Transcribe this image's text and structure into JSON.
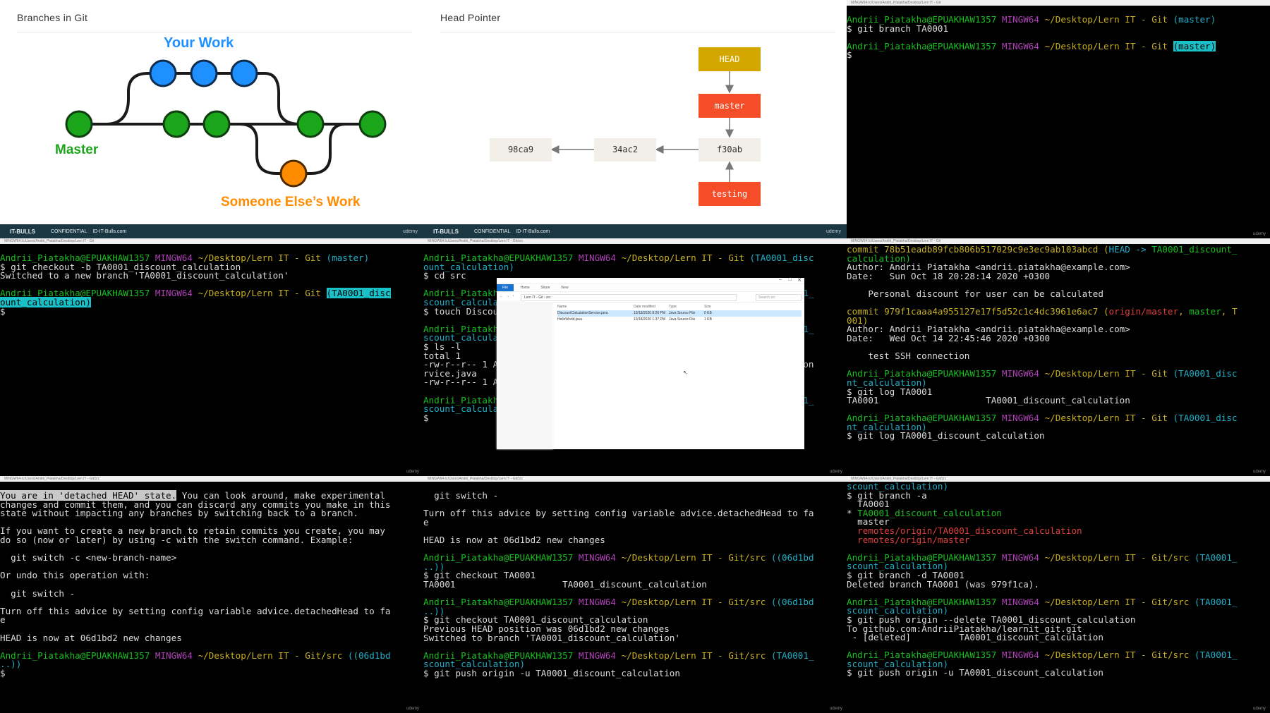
{
  "colors": {
    "green": "#18c020",
    "magenta": "#b040b8",
    "yellow": "#c8b020",
    "cyan": "#20b0c8",
    "red": "#e0403c",
    "highlight": "#1ac0c8",
    "node_green": "#1aa51a",
    "node_blue": "#1e90ff",
    "node_orange": "#ff8c00",
    "head_gold": "#d4a700",
    "branch_red": "#f44d27",
    "commit_box": "#f1efe7"
  },
  "slide1": {
    "title": "Branches in Git",
    "your_work": "Your Work",
    "master": "Master",
    "someone": "Someone Else’s Work",
    "footer_logo": "IT-BULLS",
    "footer_conf": "CONFIDENTIAL",
    "footer_site": "ID-IT-Bulls.com",
    "footer_mark": "udemy"
  },
  "slide2": {
    "title": "Head Pointer",
    "head": "HEAD",
    "master": "master",
    "testing": "testing",
    "commits": [
      "98ca9",
      "34ac2",
      "f30ab"
    ],
    "footer_logo": "IT-BULLS",
    "footer_conf": "CONFIDENTIAL",
    "footer_site": "ID-IT-Bulls.com",
    "footer_mark": "udemy"
  },
  "titlebars": {
    "p3": "MINGW64:/c/Users/Andrii_Piatakha/Desktop/Lern IT - Git",
    "p4": "MINGW64:/c/Users/Andrii_Piatakha/Desktop/Lern IT - Git",
    "p5": "MINGW64:/c/Users/Andrii_Piatakha/Desktop/Lern IT - Git/src",
    "p6": "MINGW64:/c/Users/Andrii_Piatakha/Desktop/Lern IT - Git",
    "p7": "MINGW64:/c/Users/Andrii_Piatakha/Desktop/Lern IT - Git/src",
    "p8": "MINGW64:/c/Users/Andrii_Piatakha/Desktop/Lern IT - Git/src",
    "p9": "MINGW64:/c/Users/Andrii_Piatakha/Desktop/Lern IT - Git/src"
  },
  "watermark": "udemy",
  "explorer": {
    "path": "Lern IT - Git › src",
    "search": "Search src",
    "cols": [
      "Name",
      "Date modified",
      "Type",
      "Size"
    ],
    "files": [
      {
        "name": "DiscountCalculationService.java",
        "date": "10/18/2020 8:26 PM",
        "type": "Java Source File",
        "size": "0 KB"
      },
      {
        "name": "HelloWorld.java",
        "date": "10/18/2020 1:37 PM",
        "type": "Java Source File",
        "size": "1 KB"
      }
    ]
  },
  "terminals": {
    "p3": [
      [
        [
          "Andrii_Piatakha@EPUAKHAW1357",
          "g"
        ],
        [
          " MINGW64",
          "m"
        ],
        [
          " ~/Desktop/Lern IT - Git",
          "y"
        ],
        [
          " (master)",
          "c"
        ]
      ],
      [
        [
          "$ git branch TA0001",
          ""
        ]
      ],
      [
        [
          "",
          ""
        ]
      ],
      [
        [
          "Andrii_Piatakha@EPUAKHAW1357",
          "g"
        ],
        [
          " MINGW64",
          "m"
        ],
        [
          " ~/Desktop/Lern IT - Git",
          "y"
        ],
        [
          " ",
          ""
        ],
        [
          "(master)",
          "hl"
        ]
      ],
      [
        [
          "$ ",
          ""
        ]
      ]
    ],
    "p4": [
      [
        [
          "Andrii_Piatakha@EPUAKHAW1357",
          "g"
        ],
        [
          " MINGW64",
          "m"
        ],
        [
          " ~/Desktop/Lern IT - Git",
          "y"
        ],
        [
          " (master)",
          "c"
        ]
      ],
      [
        [
          "$ git checkout -b TA0001_discount_calculation",
          ""
        ]
      ],
      [
        [
          "Switched to a new branch 'TA0001_discount_calculation'",
          ""
        ]
      ],
      [
        [
          "",
          ""
        ]
      ],
      [
        [
          "Andrii_Piatakha@EPUAKHAW1357",
          "g"
        ],
        [
          " MINGW64",
          "m"
        ],
        [
          " ~/Desktop/Lern IT - Git",
          "y"
        ],
        [
          " ",
          ""
        ],
        [
          "(TA0001_disc",
          "hl"
        ]
      ],
      [
        [
          "ount_calculation)",
          "hl"
        ]
      ],
      [
        [
          "$ ",
          ""
        ]
      ],
      [
        [
          "",
          ""
        ]
      ],
      [
        [
          "",
          ""
        ]
      ],
      [
        [
          "",
          ""
        ]
      ],
      [
        [
          "",
          ""
        ]
      ],
      [
        [
          "",
          ""
        ]
      ],
      [
        [
          "",
          ""
        ]
      ],
      [
        [
          "",
          ""
        ]
      ],
      [
        [
          "",
          ""
        ]
      ],
      [
        [
          "",
          ""
        ]
      ]
    ],
    "p5": [
      [
        [
          "Andrii_Piatakha@EPUAKHAW1357",
          "g"
        ],
        [
          " MINGW64",
          "m"
        ],
        [
          " ~/Desktop/Lern IT - Git",
          "y"
        ],
        [
          " (TA0001_disc",
          "c"
        ]
      ],
      [
        [
          "ount_calculation)",
          "c"
        ]
      ],
      [
        [
          "$ cd src",
          ""
        ]
      ],
      [
        [
          "",
          ""
        ]
      ],
      [
        [
          "Andrii_Piatakha@EPUAKHAW1357",
          "g"
        ],
        [
          " MINGW64",
          "m"
        ],
        [
          " ~/Desktop/Lern IT - Git/src",
          "y"
        ],
        [
          " (TA0001_",
          "c"
        ]
      ],
      [
        [
          "scount_calculation)",
          "c"
        ]
      ],
      [
        [
          "$ touch DiscountCalculationService.java",
          ""
        ]
      ],
      [
        [
          "",
          ""
        ]
      ],
      [
        [
          "Andrii_Piatakha@EPUAKHAW1357",
          "g"
        ],
        [
          " MINGW64",
          "m"
        ],
        [
          " ~/Desktop/Lern IT - Git/src",
          "y"
        ],
        [
          " (TA0001_",
          "c"
        ]
      ],
      [
        [
          "scount_calculation)",
          "c"
        ]
      ],
      [
        [
          "$ ls -l",
          ""
        ]
      ],
      [
        [
          "total 1",
          ""
        ]
      ],
      [
        [
          "-rw-r--r-- 1 Andrii_Piatakha 1049089   0 Oct 18 20:26 DiscountCalculation",
          ""
        ]
      ],
      [
        [
          "rvice.java                                              ulation",
          ""
        ]
      ],
      [
        [
          "-rw-r--r-- 1 Andrii_Piatakha 1049089 120 Oct 18 13:37 HelloWorld.java",
          ""
        ]
      ],
      [
        [
          "",
          ""
        ]
      ],
      [
        [
          "Andrii_Piatakha@EPUAKHAW1357",
          "g"
        ],
        [
          " MINGW64",
          "m"
        ],
        [
          " ~/Desktop/Lern IT - Git/src",
          "y"
        ],
        [
          " (TA0001_",
          "c"
        ]
      ],
      [
        [
          "scount_calculation)",
          "c"
        ]
      ],
      [
        [
          "$ ",
          ""
        ]
      ]
    ],
    "p6": [
      [
        [
          "commit 78b51eadb89fcb806b517029c9e3ec9ab103abcd",
          "y"
        ],
        [
          " (",
          "y"
        ],
        [
          "HEAD -> ",
          "c"
        ],
        [
          "TA0001_discount_",
          "g"
        ]
      ],
      [
        [
          "calculation)",
          "g"
        ]
      ],
      [
        [
          "Author: Andrii Piatakha <andrii.piatakha@example.com>",
          ""
        ]
      ],
      [
        [
          "Date:   Sun Oct 18 20:28:14 2020 +0300",
          ""
        ]
      ],
      [
        [
          "",
          ""
        ]
      ],
      [
        [
          "    Personal discount for user can be calculated",
          ""
        ]
      ],
      [
        [
          "",
          ""
        ]
      ],
      [
        [
          "commit 979f1caaa4a955127e17f5d52c1c4dc3961e6ac7",
          "y"
        ],
        [
          " (",
          "y"
        ],
        [
          "origin/master",
          "r"
        ],
        [
          ", ",
          "y"
        ],
        [
          "master",
          "g"
        ],
        [
          ", T",
          "y"
        ]
      ],
      [
        [
          "001)",
          "y"
        ]
      ],
      [
        [
          "Author: Andrii Piatakha <andrii.piatakha@example.com>",
          ""
        ]
      ],
      [
        [
          "Date:   Wed Oct 14 22:45:46 2020 +0300",
          ""
        ]
      ],
      [
        [
          "",
          ""
        ]
      ],
      [
        [
          "    test SSH connection",
          ""
        ]
      ],
      [
        [
          "",
          ""
        ]
      ],
      [
        [
          "Andrii_Piatakha@EPUAKHAW1357",
          "g"
        ],
        [
          " MINGW64",
          "m"
        ],
        [
          " ~/Desktop/Lern IT - Git",
          "y"
        ],
        [
          " (TA0001_disc",
          "c"
        ]
      ],
      [
        [
          "nt_calculation)",
          "c"
        ]
      ],
      [
        [
          "$ git log TA0001",
          ""
        ]
      ],
      [
        [
          "TA0001                    TA0001_discount_calculation",
          ""
        ]
      ],
      [
        [
          "",
          ""
        ]
      ],
      [
        [
          "Andrii_Piatakha@EPUAKHAW1357",
          "g"
        ],
        [
          " MINGW64",
          "m"
        ],
        [
          " ~/Desktop/Lern IT - Git",
          "y"
        ],
        [
          " (TA0001_disc",
          "c"
        ]
      ],
      [
        [
          "nt_calculation)",
          "c"
        ]
      ],
      [
        [
          "$ git log TA0001_discount_calculation ",
          ""
        ]
      ]
    ],
    "p7": [
      [
        [
          "You are in 'detached HEAD' state.",
          "hlw"
        ],
        [
          " You can look around, make experimental",
          ""
        ]
      ],
      [
        [
          "changes and commit them, and you can discard any commits you make in this",
          ""
        ]
      ],
      [
        [
          "state without impacting any branches by switching back to a branch.",
          ""
        ]
      ],
      [
        [
          "",
          ""
        ]
      ],
      [
        [
          "If you want to create a new branch to retain commits you create, you may",
          ""
        ]
      ],
      [
        [
          "do so (now or later) by using -c with the switch command. Example:",
          ""
        ]
      ],
      [
        [
          "",
          ""
        ]
      ],
      [
        [
          "  git switch -c <new-branch-name>",
          ""
        ]
      ],
      [
        [
          "",
          ""
        ]
      ],
      [
        [
          "Or undo this operation with:",
          ""
        ]
      ],
      [
        [
          "",
          ""
        ]
      ],
      [
        [
          "  git switch -",
          ""
        ]
      ],
      [
        [
          "",
          ""
        ]
      ],
      [
        [
          "Turn off this advice by setting config variable advice.detachedHead to fa",
          ""
        ]
      ],
      [
        [
          "e",
          ""
        ]
      ],
      [
        [
          "",
          ""
        ]
      ],
      [
        [
          "HEAD is now at 06d1bd2 new changes",
          ""
        ]
      ],
      [
        [
          "",
          ""
        ]
      ],
      [
        [
          "Andrii_Piatakha@EPUAKHAW1357",
          "g"
        ],
        [
          " MINGW64",
          "m"
        ],
        [
          " ~/Desktop/Lern IT - Git/src",
          "y"
        ],
        [
          " ((06d1bd",
          "c"
        ]
      ],
      [
        [
          "..))",
          "c"
        ]
      ],
      [
        [
          "$ ",
          ""
        ]
      ]
    ],
    "p8": [
      [
        [
          "  git switch -",
          ""
        ]
      ],
      [
        [
          "",
          ""
        ]
      ],
      [
        [
          "Turn off this advice by setting config variable advice.detachedHead to fa",
          ""
        ]
      ],
      [
        [
          "e",
          ""
        ]
      ],
      [
        [
          "",
          ""
        ]
      ],
      [
        [
          "HEAD is now at 06d1bd2 new changes",
          ""
        ]
      ],
      [
        [
          "",
          ""
        ]
      ],
      [
        [
          "Andrii_Piatakha@EPUAKHAW1357",
          "g"
        ],
        [
          " MINGW64",
          "m"
        ],
        [
          " ~/Desktop/Lern IT - Git/src",
          "y"
        ],
        [
          " ((06d1bd",
          "c"
        ]
      ],
      [
        [
          "..))",
          "c"
        ]
      ],
      [
        [
          "$ git checkout TA0001",
          ""
        ]
      ],
      [
        [
          "TA0001                    TA0001_discount_calculation",
          ""
        ]
      ],
      [
        [
          "",
          ""
        ]
      ],
      [
        [
          "Andrii_Piatakha@EPUAKHAW1357",
          "g"
        ],
        [
          " MINGW64",
          "m"
        ],
        [
          " ~/Desktop/Lern IT - Git/src",
          "y"
        ],
        [
          " ((06d1bd",
          "c"
        ]
      ],
      [
        [
          "..))",
          "c"
        ]
      ],
      [
        [
          "$ git checkout TA0001_discount_calculation",
          ""
        ]
      ],
      [
        [
          "Previous HEAD position was 06d1bd2 new changes",
          ""
        ]
      ],
      [
        [
          "Switched to branch 'TA0001_discount_calculation'",
          ""
        ]
      ],
      [
        [
          "",
          ""
        ]
      ],
      [
        [
          "Andrii_Piatakha@EPUAKHAW1357",
          "g"
        ],
        [
          " MINGW64",
          "m"
        ],
        [
          " ~/Desktop/Lern IT - Git/src",
          "y"
        ],
        [
          " (TA0001_",
          "c"
        ]
      ],
      [
        [
          "scount_calculation)",
          "c"
        ]
      ],
      [
        [
          "$ git push origin -u TA0001_discount_calculation ",
          ""
        ]
      ]
    ],
    "p9": [
      [
        [
          "scount_calculation)",
          "c"
        ]
      ],
      [
        [
          "$ git branch -a",
          ""
        ]
      ],
      [
        [
          "  TA0001",
          ""
        ]
      ],
      [
        [
          "* ",
          ""
        ],
        [
          "TA0001_discount_calculation",
          "g"
        ]
      ],
      [
        [
          "  master",
          ""
        ]
      ],
      [
        [
          "  remotes/origin/TA0001_discount_calculation",
          "r"
        ]
      ],
      [
        [
          "  remotes/origin/master",
          "r"
        ]
      ],
      [
        [
          "",
          ""
        ]
      ],
      [
        [
          "Andrii_Piatakha@EPUAKHAW1357",
          "g"
        ],
        [
          " MINGW64",
          "m"
        ],
        [
          " ~/Desktop/Lern IT - Git/src",
          "y"
        ],
        [
          " (TA0001_",
          "c"
        ]
      ],
      [
        [
          "scount_calculation)",
          "c"
        ]
      ],
      [
        [
          "$ git branch -d TA0001",
          ""
        ]
      ],
      [
        [
          "Deleted branch TA0001 (was 979f1ca).",
          ""
        ]
      ],
      [
        [
          "",
          ""
        ]
      ],
      [
        [
          "Andrii_Piatakha@EPUAKHAW1357",
          "g"
        ],
        [
          " MINGW64",
          "m"
        ],
        [
          " ~/Desktop/Lern IT - Git/src",
          "y"
        ],
        [
          " (TA0001_",
          "c"
        ]
      ],
      [
        [
          "scount_calculation)",
          "c"
        ]
      ],
      [
        [
          "$ git push origin --delete TA0001_discount_calculation",
          ""
        ]
      ],
      [
        [
          "To github.com:AndriiPiatakha/learnit_git.git",
          ""
        ]
      ],
      [
        [
          " - [deleted]         TA0001_discount_calculation",
          ""
        ]
      ],
      [
        [
          "",
          ""
        ]
      ],
      [
        [
          "Andrii_Piatakha@EPUAKHAW1357",
          "g"
        ],
        [
          " MINGW64",
          "m"
        ],
        [
          " ~/Desktop/Lern IT - Git/src",
          "y"
        ],
        [
          " (TA0001_",
          "c"
        ]
      ],
      [
        [
          "scount_calculation)",
          "c"
        ]
      ],
      [
        [
          "$ git push origin -u TA0001_discount_calculation ",
          ""
        ]
      ]
    ]
  }
}
